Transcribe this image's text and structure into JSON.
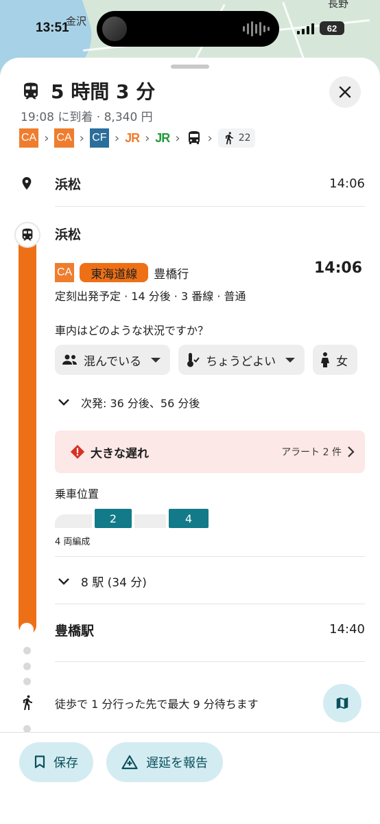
{
  "map": {
    "labels": [
      "金沢",
      "長野"
    ]
  },
  "status_bar": {
    "time": "13:51",
    "battery": "62"
  },
  "header": {
    "duration": "5 時間 3 分",
    "arrival": "19:08 に到着 · 8,340 円",
    "route_chips": [
      "CA",
      "CA",
      "CF",
      "JR",
      "JR"
    ],
    "walk_minutes": "22"
  },
  "origin": {
    "name": "浜松",
    "time": "14:06"
  },
  "boarding_stop": {
    "name": "浜松"
  },
  "transit": {
    "line_badge": "CA",
    "line_name": "東海道線",
    "destination": "豊橋行",
    "departure_time": "14:06",
    "schedule": "定刻出発予定 · 14 分後 · 3 番線 · 普通",
    "crowd_question": "車内はどのような状況ですか？",
    "feedback_chips": [
      "混んでいる",
      "ちょうどよい",
      "女"
    ],
    "next_departures": "次発: 36 分後、56 分後",
    "alert_title": "大きな遅れ",
    "alert_count": "アラート 2 件",
    "boarding_position_label": "乗車位置",
    "cars": [
      "",
      "2",
      "",
      "4"
    ],
    "formation": "4 両編成",
    "stations": "8 駅 (34 分)"
  },
  "arrival_stop": {
    "name": "豊橋駅",
    "time": "14:40"
  },
  "walk": {
    "text": "徒歩で 1 分行った先で最大 9 分待ちます"
  },
  "footer": {
    "save": "保存",
    "report": "遅延を報告"
  },
  "colors": {
    "line": "#ee7016",
    "accent": "#127a89",
    "button_bg": "#d3ecf2",
    "alert_bg": "#fce8e6"
  }
}
